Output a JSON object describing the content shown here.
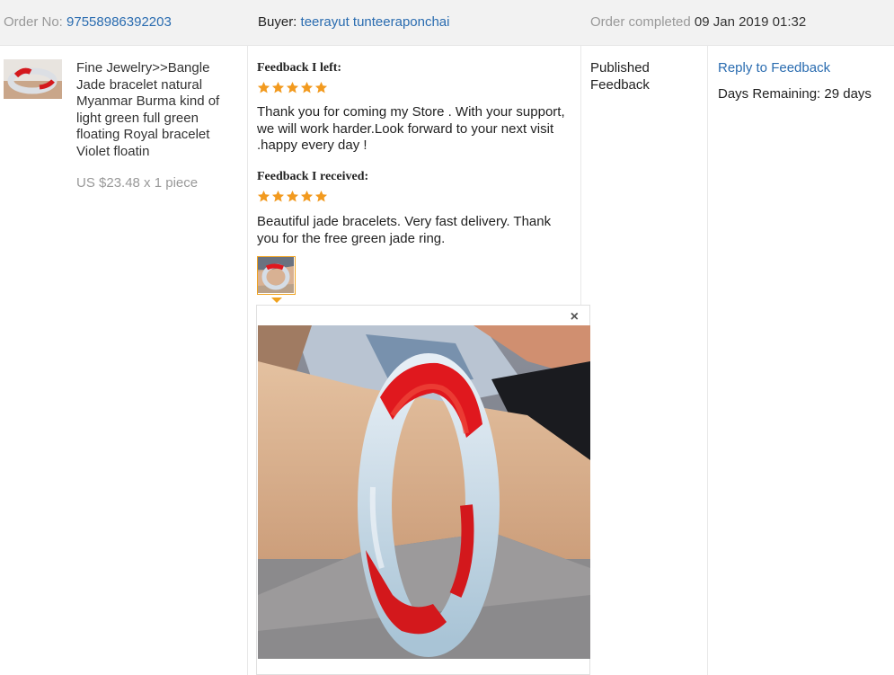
{
  "header": {
    "order_no_label": "Order No:",
    "order_no": "97558986392203",
    "buyer_label": "Buyer:",
    "buyer": "teerayut tunteeraponchai",
    "status_label": "Order completed",
    "status_date": "09 Jan 2019 01:32"
  },
  "product": {
    "title": "Fine Jewelry>>Bangle Jade bracelet natural Myanmar Burma kind of light green full green floating Royal bracelet Violet floatin",
    "price": "US $23.48 x 1 piece"
  },
  "feedback_left": {
    "title": "Feedback I left:",
    "rating": 5,
    "text": "Thank you for coming my Store . With your support, we will work harder.Look forward to your next visit .happy every day !"
  },
  "feedback_received": {
    "title": "Feedback I received:",
    "rating": 5,
    "text": "Beautiful jade bracelets. Very fast delivery. Thank you for the free green jade ring."
  },
  "popup": {
    "close": "×"
  },
  "status": {
    "text": "Published Feedback"
  },
  "actions": {
    "reply": "Reply to Feedback",
    "days_remaining": "Days Remaining: 29 days"
  },
  "colors": {
    "link": "#2a6cb0",
    "star": "#f29a1f",
    "header_bg": "#f2f2f2",
    "bangle_red": "#e0181e"
  },
  "icons": {
    "star": "star-icon",
    "close": "close-icon",
    "caret": "caret-down-icon"
  }
}
